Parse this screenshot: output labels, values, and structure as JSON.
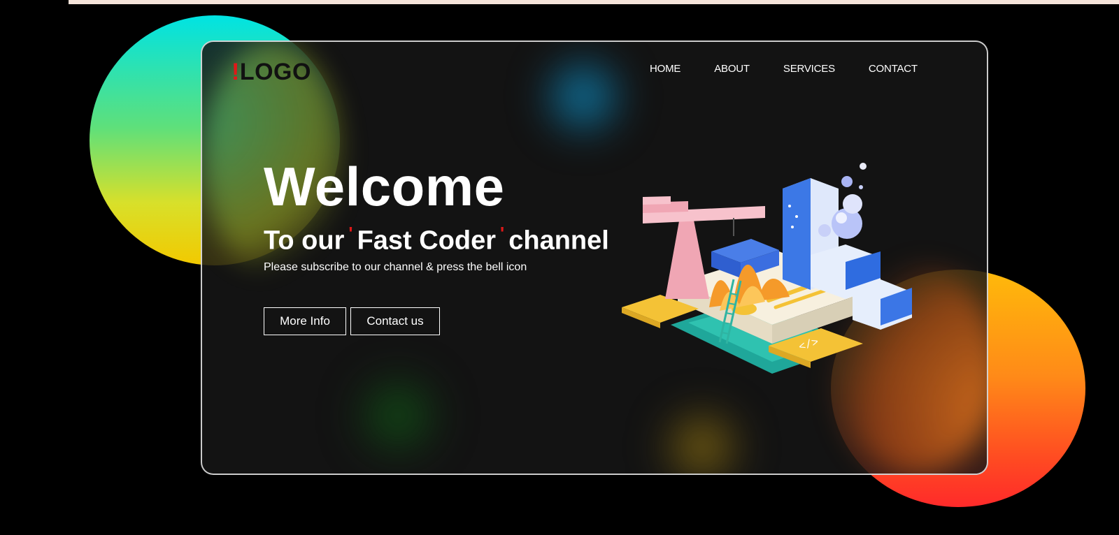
{
  "header": {
    "logo_mark": "!",
    "logo_text": "LOGO"
  },
  "nav": {
    "items": [
      {
        "label": "HOME"
      },
      {
        "label": "ABOUT"
      },
      {
        "label": "SERVICES"
      },
      {
        "label": "CONTACT"
      }
    ]
  },
  "hero": {
    "title": "Welcome",
    "subtitle_prefix": "To our",
    "subtitle_quote_open": "'",
    "subtitle_highlight": "Fast Coder",
    "subtitle_quote_close": "'",
    "subtitle_suffix": "channel",
    "description": "Please subscribe to our channel & press the bell icon"
  },
  "buttons": {
    "more_info": "More Info",
    "contact_us": "Contact us"
  },
  "colors": {
    "background": "#000000",
    "card": "#161616",
    "accent_red": "#e01818",
    "circle_left_top": "#00e3e3",
    "circle_left_bottom": "#f2c900",
    "circle_right_top": "#ffba0a",
    "circle_right_bottom": "#ff2a2a"
  },
  "icons": {
    "illustration": "isometric-coding-platform-illustration"
  }
}
